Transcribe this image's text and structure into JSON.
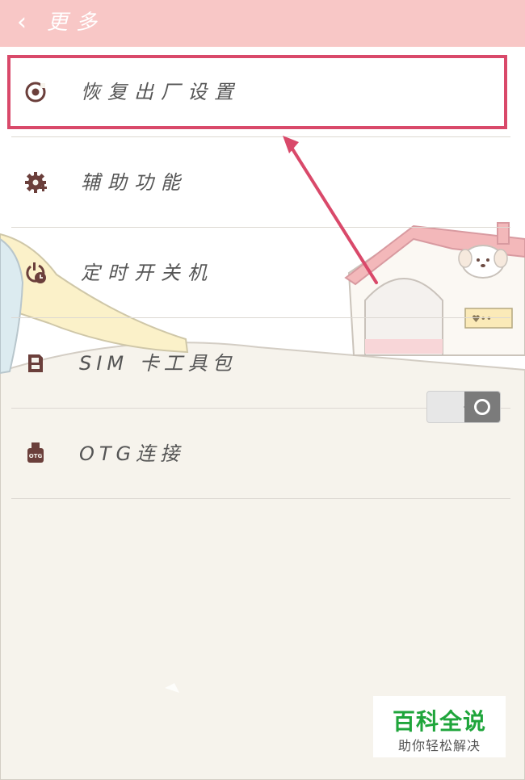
{
  "header": {
    "back_icon": "chevron-left-icon",
    "title": "更多"
  },
  "menu": [
    {
      "label": "恢复出厂设置",
      "icon": "factory-reset-icon"
    },
    {
      "label": "辅助功能",
      "icon": "gear-icon"
    },
    {
      "label": "定时开关机",
      "icon": "power-timer-icon"
    },
    {
      "label": "SIM 卡工具包",
      "icon": "sim-card-icon"
    },
    {
      "label": "OTG连接",
      "icon": "otg-icon"
    }
  ],
  "otg_toggle": {
    "state": "off"
  },
  "watermark": {
    "title": "百科全说",
    "subtitle": "助你轻松解决"
  },
  "colors": {
    "header_bg": "#f8c7c6",
    "highlight": "#d9496a",
    "icon": "#6b3f3b",
    "watermark_green": "#1fa53b"
  }
}
